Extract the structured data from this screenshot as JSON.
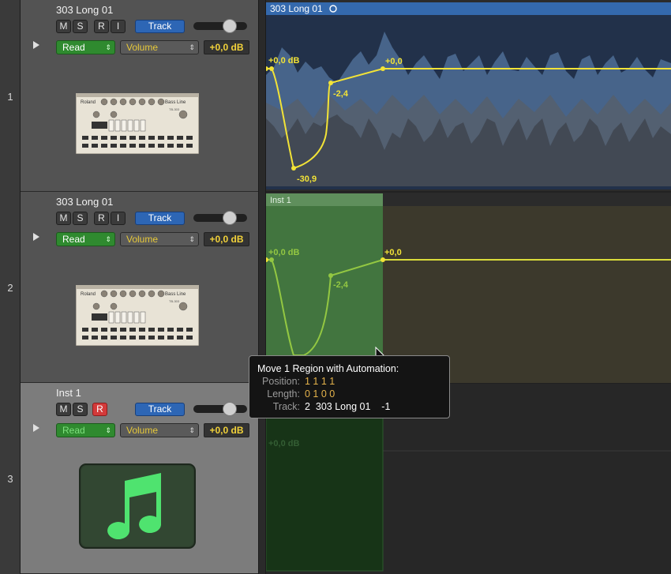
{
  "tracks": [
    {
      "number": "1",
      "name": "303 Long 01",
      "buttons": [
        "M",
        "S",
        "R",
        "I"
      ],
      "track_label": "Track",
      "mode": "Read",
      "parameter": "Volume",
      "value": "+0,0 dB",
      "icon": "tb303-synth-icon"
    },
    {
      "number": "2",
      "name": "303 Long 01",
      "buttons": [
        "M",
        "S",
        "R",
        "I"
      ],
      "track_label": "Track",
      "mode": "Read",
      "parameter": "Volume",
      "value": "+0,0 dB",
      "icon": "tb303-synth-icon"
    },
    {
      "number": "3",
      "name": "Inst 1",
      "buttons": [
        "M",
        "S",
        "R"
      ],
      "track_label": "Track",
      "mode": "Read",
      "parameter": "Volume",
      "value": "+0,0 dB",
      "icon": "music-note-icon"
    }
  ],
  "synth_labels": {
    "brand": "Roland",
    "series": "Bass Line",
    "model": "TB-303"
  },
  "regions": {
    "audio": {
      "name": "303 Long 01",
      "loop_icon": "loop-circle-icon"
    },
    "midi": {
      "name": "Inst 1"
    }
  },
  "automation": {
    "lane1": {
      "start": "+0,0 dB",
      "min": "-30,9",
      "mid": "-2,4",
      "end": "+0,0"
    },
    "lane2": {
      "start": "+0,0 dB",
      "mid": "-2,4",
      "end": "+0,0"
    },
    "lane3": {
      "start": "+0,0 dB"
    }
  },
  "tooltip": {
    "title": "Move 1 Region with Automation:",
    "position_label": "Position:",
    "position_value": "1 1 1 1",
    "length_label": "Length:",
    "length_value": "0 1 0 0",
    "track_label": "Track:",
    "track_value": "2  303 Long 01    -1"
  },
  "colors": {
    "automation_yellow": "#f2e337",
    "automation_green": "#7fbf3f",
    "read_green": "#2f8a2f",
    "track_blue": "#2d66b5",
    "region_blue": "#2f5b97"
  }
}
